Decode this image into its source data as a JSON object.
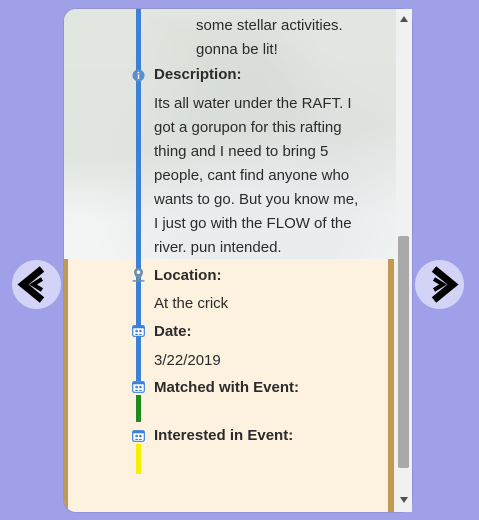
{
  "event": {
    "fragment_line1": "some stellar activities.",
    "fragment_line2": "gonna be lit!",
    "description_label": "Description:",
    "description_lines": [
      "Its all water under the RAFT. I",
      "got a gorupon for this rafting",
      "thing and I need to bring 5",
      "people, cant find anyone who",
      "wants to go. But you know me,",
      "I just go with the FLOW of the",
      "river. pun intended."
    ],
    "location_label": "Location:",
    "location_value": "At the crick",
    "date_label": "Date:",
    "date_value": "3/22/2019",
    "matched_label": "Matched with Event:",
    "interested_label": "Interested in Event:"
  },
  "icons": {
    "info": "info-icon",
    "location": "map-pin-icon",
    "date": "calendar-people-icon",
    "matched": "calendar-people-icon",
    "interested": "calendar-people-icon",
    "prev": "chevron-left-icon",
    "next": "chevron-right-icon"
  },
  "colors": {
    "page_background": "#9fa0e8",
    "card_background": "#fdf1df",
    "timeline_blue": "#3b82d6",
    "timeline_green": "#1f8a1f",
    "timeline_yellow": "#f4f000",
    "card_edge": "#c09a55",
    "nav_button": "#d2d3f6"
  }
}
